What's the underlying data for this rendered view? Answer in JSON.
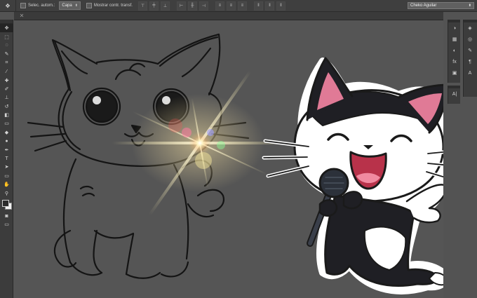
{
  "options_bar": {
    "tool_icon": "move-tool-icon",
    "auto_select_label": "Selec. autom.:",
    "auto_select_value": "Capa",
    "show_transform_label": "Mostrar contr. transf."
  },
  "workspace": {
    "user_name": "Cheko Aguilar"
  },
  "tools": [
    {
      "id": "move",
      "glyph": "✥"
    },
    {
      "id": "marquee",
      "glyph": "⬚"
    },
    {
      "id": "lasso",
      "glyph": "◌"
    },
    {
      "id": "quick-select",
      "glyph": "✎"
    },
    {
      "id": "crop",
      "glyph": "⌗"
    },
    {
      "id": "eyedropper",
      "glyph": "⁄"
    },
    {
      "id": "healing",
      "glyph": "✚"
    },
    {
      "id": "brush",
      "glyph": "✐"
    },
    {
      "id": "stamp",
      "glyph": "⊥"
    },
    {
      "id": "history-brush",
      "glyph": "↺"
    },
    {
      "id": "eraser",
      "glyph": "◧"
    },
    {
      "id": "gradient",
      "glyph": "▭"
    },
    {
      "id": "blur",
      "glyph": "◆"
    },
    {
      "id": "dodge",
      "glyph": "●"
    },
    {
      "id": "pen",
      "glyph": "✒"
    },
    {
      "id": "type",
      "glyph": "T"
    },
    {
      "id": "path-select",
      "glyph": "➤"
    },
    {
      "id": "shape",
      "glyph": "▭"
    },
    {
      "id": "hand",
      "glyph": "✋"
    },
    {
      "id": "zoom",
      "glyph": "⚲"
    }
  ],
  "colors": {
    "foreground": "#2a2a2a",
    "background": "#f1f1f1",
    "canvas": "#555555",
    "ui_dark": "#3c3c3c"
  },
  "right_dock_upper": [
    "color-icon",
    "swatches-icon",
    "adjustments-icon",
    "styles-icon",
    "mask-icon"
  ],
  "right_dock_lower": [
    "layers-icon",
    "channels-icon",
    "paths-icon",
    "paragraph-icon",
    "character-icon"
  ],
  "right_dock_labels": {
    "character_label": "A|",
    "paragraph_label": "¶"
  }
}
